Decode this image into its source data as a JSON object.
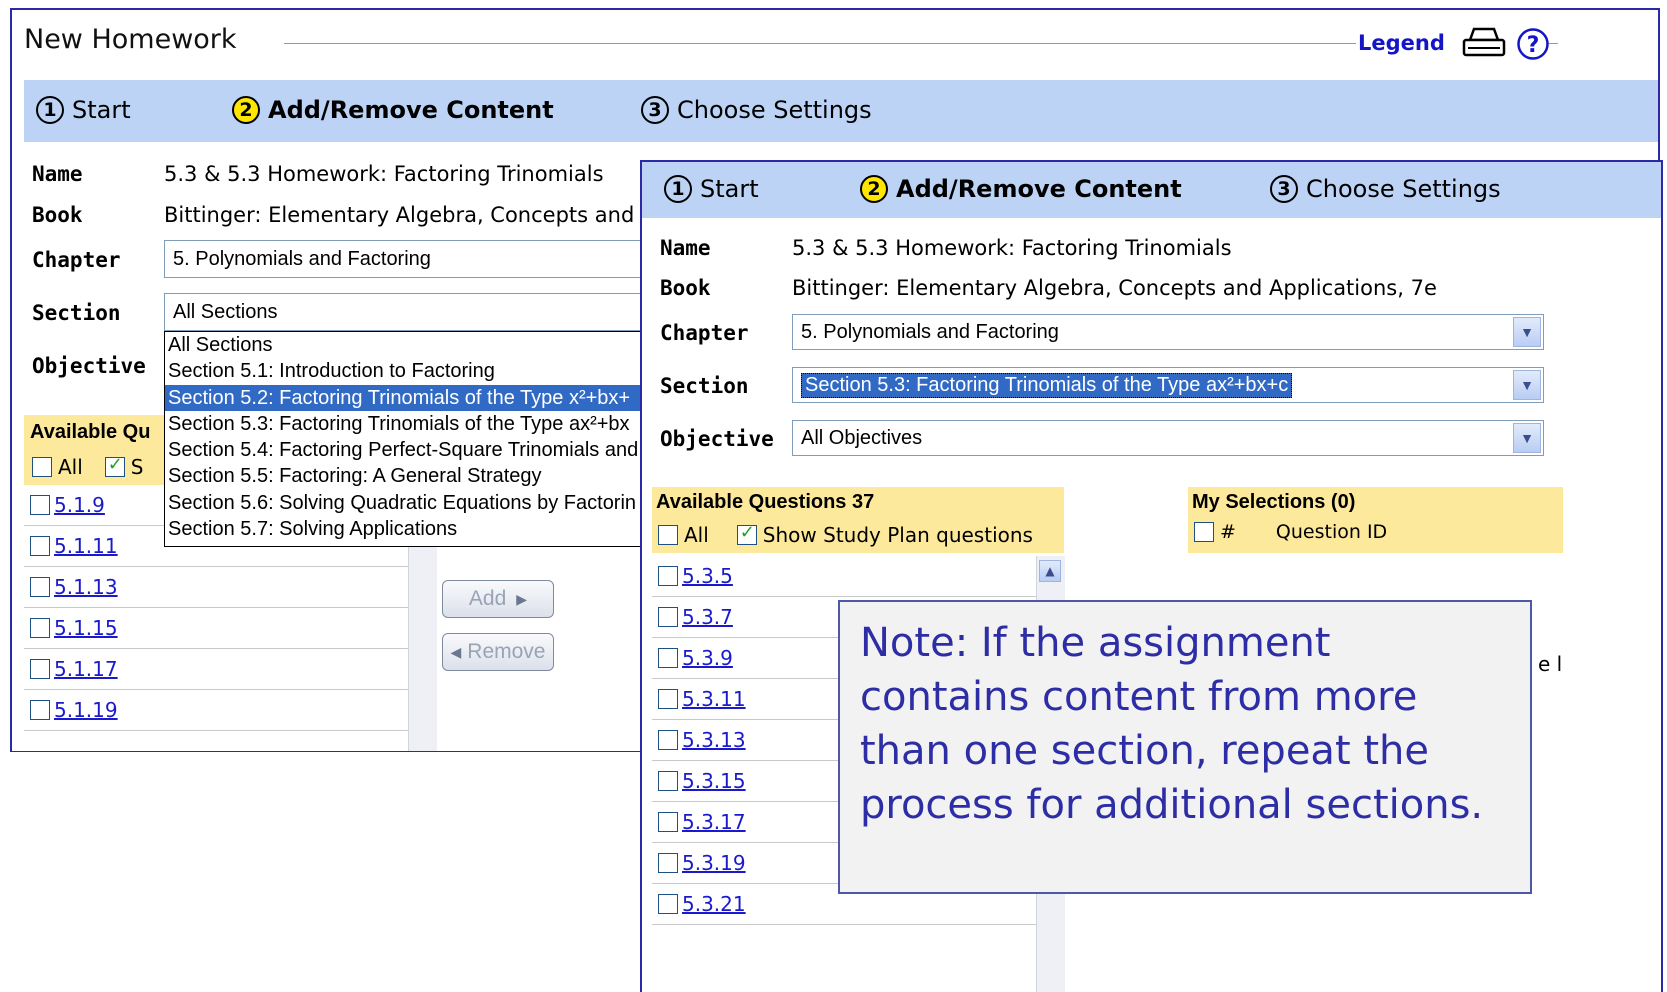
{
  "window1": {
    "title": "New Homework",
    "legend_label": "Legend",
    "steps": [
      {
        "num": "1",
        "label": "Start"
      },
      {
        "num": "2",
        "label": "Add/Remove Content"
      },
      {
        "num": "3",
        "label": "Choose Settings"
      }
    ],
    "name_label": "Name",
    "name_value": "5.3 & 5.3 Homework: Factoring Trinomials",
    "book_label": "Book",
    "book_value": "Bittinger: Elementary Algebra, Concepts and",
    "chapter_label": "Chapter",
    "chapter_value": "5. Polynomials and Factoring",
    "section_label": "Section",
    "section_value": "All Sections",
    "objective_label": "Objective",
    "section_options": [
      "All Sections",
      "Section 5.1: Introduction to Factoring",
      "Section 5.2: Factoring Trinomials of the Type x²+bx+",
      "Section 5.3: Factoring Trinomials of the Type ax²+bx",
      "Section 5.4: Factoring Perfect-Square Trinomials and",
      "Section 5.5: Factoring: A General Strategy",
      "Section 5.6: Solving Quadratic Equations by Factorin",
      "Section 5.7: Solving Applications"
    ],
    "available_header": "Available Qu",
    "all_label": "All",
    "show_label": "S",
    "questions": [
      "5.1.9",
      "5.1.11",
      "5.1.13",
      "5.1.15",
      "5.1.17",
      "5.1.19"
    ],
    "add_label": "Add",
    "remove_label": "Remove"
  },
  "window2": {
    "steps": [
      {
        "num": "1",
        "label": "Start"
      },
      {
        "num": "2",
        "label": "Add/Remove Content"
      },
      {
        "num": "3",
        "label": "Choose Settings"
      }
    ],
    "name_label": "Name",
    "name_value": "5.3 & 5.3 Homework: Factoring Trinomials",
    "book_label": "Book",
    "book_value": "Bittinger: Elementary Algebra, Concepts and Applications, 7e",
    "chapter_label": "Chapter",
    "chapter_value": "5. Polynomials and Factoring",
    "section_label": "Section",
    "section_value": "Section 5.3: Factoring Trinomials of the Type ax²+bx+c",
    "objective_label": "Objective",
    "objective_value": "All Objectives",
    "available_header": "Available Questions 37",
    "all_label": "All",
    "show_label": "Show Study Plan questions",
    "questions": [
      "5.3.5",
      "5.3.7",
      "5.3.9",
      "5.3.11",
      "5.3.13",
      "5.3.15",
      "5.3.17",
      "5.3.19",
      "5.3.21"
    ],
    "selections_header": "My Selections (0)",
    "hash_label": "#",
    "question_id_label": "Question ID",
    "clipped_text": "e l"
  },
  "note": {
    "text": "Note:  If the assignment contains content from more than one section, repeat the process for additional sections."
  },
  "icons": [
    "printer-icon",
    "help-icon",
    "dropdown-arrow-icon",
    "checkbox-icon",
    "scroll-up-icon"
  ],
  "colors": {
    "step_bar": "#bcd3f5",
    "active_step": "#ffe600",
    "header_yellow": "#fde99b",
    "selection": "#316ac5",
    "link": "#1a1acc",
    "note_text": "#2d2da5",
    "frame": "#2a2aa8"
  }
}
